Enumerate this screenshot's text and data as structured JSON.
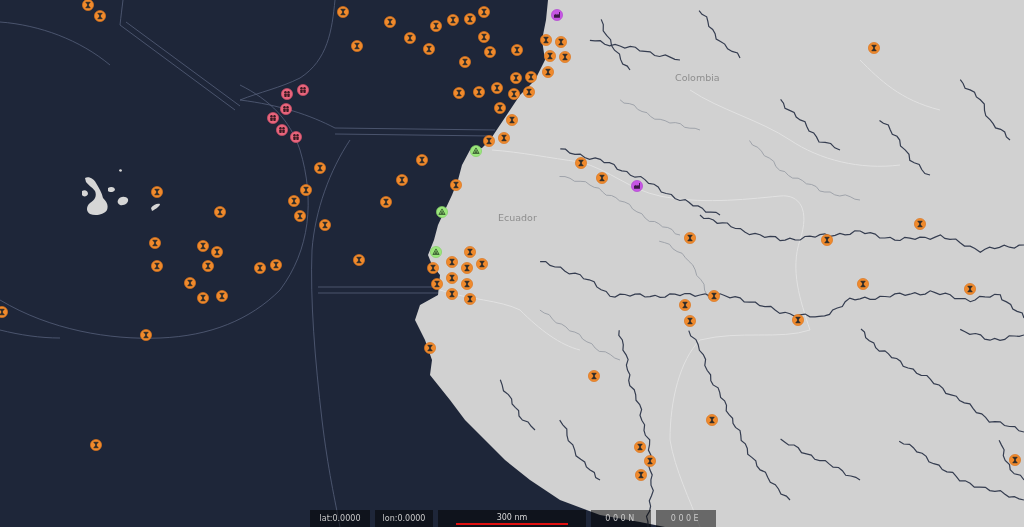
{
  "map": {
    "labels": [
      {
        "text": "Colombia"
      },
      {
        "text": "Ecuador"
      }
    ],
    "markers": [
      {
        "kind": "vessel"
      },
      {
        "kind": "vessel"
      },
      {
        "kind": "vessel"
      },
      {
        "kind": "vessel"
      },
      {
        "kind": "factory"
      },
      {
        "kind": "vessel"
      },
      {
        "kind": "vessel"
      },
      {
        "kind": "vessel"
      },
      {
        "kind": "vessel"
      },
      {
        "kind": "vessel"
      },
      {
        "kind": "vessel"
      },
      {
        "kind": "vessel"
      },
      {
        "kind": "vessel"
      },
      {
        "kind": "vessel"
      },
      {
        "kind": "vessel"
      },
      {
        "kind": "vessel"
      },
      {
        "kind": "vessel"
      },
      {
        "kind": "vessel"
      },
      {
        "kind": "vessel"
      },
      {
        "kind": "vessel"
      },
      {
        "kind": "vessel"
      },
      {
        "kind": "vessel"
      },
      {
        "kind": "vessel"
      },
      {
        "kind": "vessel"
      },
      {
        "kind": "vessel"
      },
      {
        "kind": "vessel"
      },
      {
        "kind": "group"
      },
      {
        "kind": "group"
      },
      {
        "kind": "vessel"
      },
      {
        "kind": "vessel"
      },
      {
        "kind": "vessel"
      },
      {
        "kind": "group"
      },
      {
        "kind": "vessel"
      },
      {
        "kind": "group"
      },
      {
        "kind": "vessel"
      },
      {
        "kind": "group"
      },
      {
        "kind": "group"
      },
      {
        "kind": "vessel"
      },
      {
        "kind": "vessel"
      },
      {
        "kind": "alert"
      },
      {
        "kind": "vessel"
      },
      {
        "kind": "vessel"
      },
      {
        "kind": "vessel"
      },
      {
        "kind": "vessel"
      },
      {
        "kind": "vessel"
      },
      {
        "kind": "vessel"
      },
      {
        "kind": "factory"
      },
      {
        "kind": "vessel"
      },
      {
        "kind": "vessel"
      },
      {
        "kind": "vessel"
      },
      {
        "kind": "vessel"
      },
      {
        "kind": "vessel"
      },
      {
        "kind": "alert"
      },
      {
        "kind": "vessel"
      },
      {
        "kind": "vessel"
      },
      {
        "kind": "vessel"
      },
      {
        "kind": "vessel"
      },
      {
        "kind": "vessel"
      },
      {
        "kind": "vessel"
      },
      {
        "kind": "vessel"
      },
      {
        "kind": "vessel"
      },
      {
        "kind": "alert"
      },
      {
        "kind": "vessel"
      },
      {
        "kind": "vessel"
      },
      {
        "kind": "vessel"
      },
      {
        "kind": "vessel"
      },
      {
        "kind": "vessel"
      },
      {
        "kind": "vessel"
      },
      {
        "kind": "vessel"
      },
      {
        "kind": "vessel"
      },
      {
        "kind": "vessel"
      },
      {
        "kind": "vessel"
      },
      {
        "kind": "vessel"
      },
      {
        "kind": "vessel"
      },
      {
        "kind": "vessel"
      },
      {
        "kind": "vessel"
      },
      {
        "kind": "vessel"
      },
      {
        "kind": "vessel"
      },
      {
        "kind": "vessel"
      },
      {
        "kind": "vessel"
      },
      {
        "kind": "vessel"
      },
      {
        "kind": "vessel"
      },
      {
        "kind": "vessel"
      },
      {
        "kind": "vessel"
      },
      {
        "kind": "vessel"
      },
      {
        "kind": "vessel"
      },
      {
        "kind": "vessel"
      },
      {
        "kind": "vessel"
      },
      {
        "kind": "vessel"
      },
      {
        "kind": "vessel"
      },
      {
        "kind": "vessel"
      },
      {
        "kind": "vessel"
      },
      {
        "kind": "vessel"
      },
      {
        "kind": "vessel"
      },
      {
        "kind": "vessel"
      },
      {
        "kind": "vessel"
      }
    ]
  },
  "status_bar": {
    "lat": "lat:0.0000",
    "lon": "lon:0.0000",
    "scale": "300 nm",
    "latitude": "000N",
    "longitude": "000E"
  }
}
